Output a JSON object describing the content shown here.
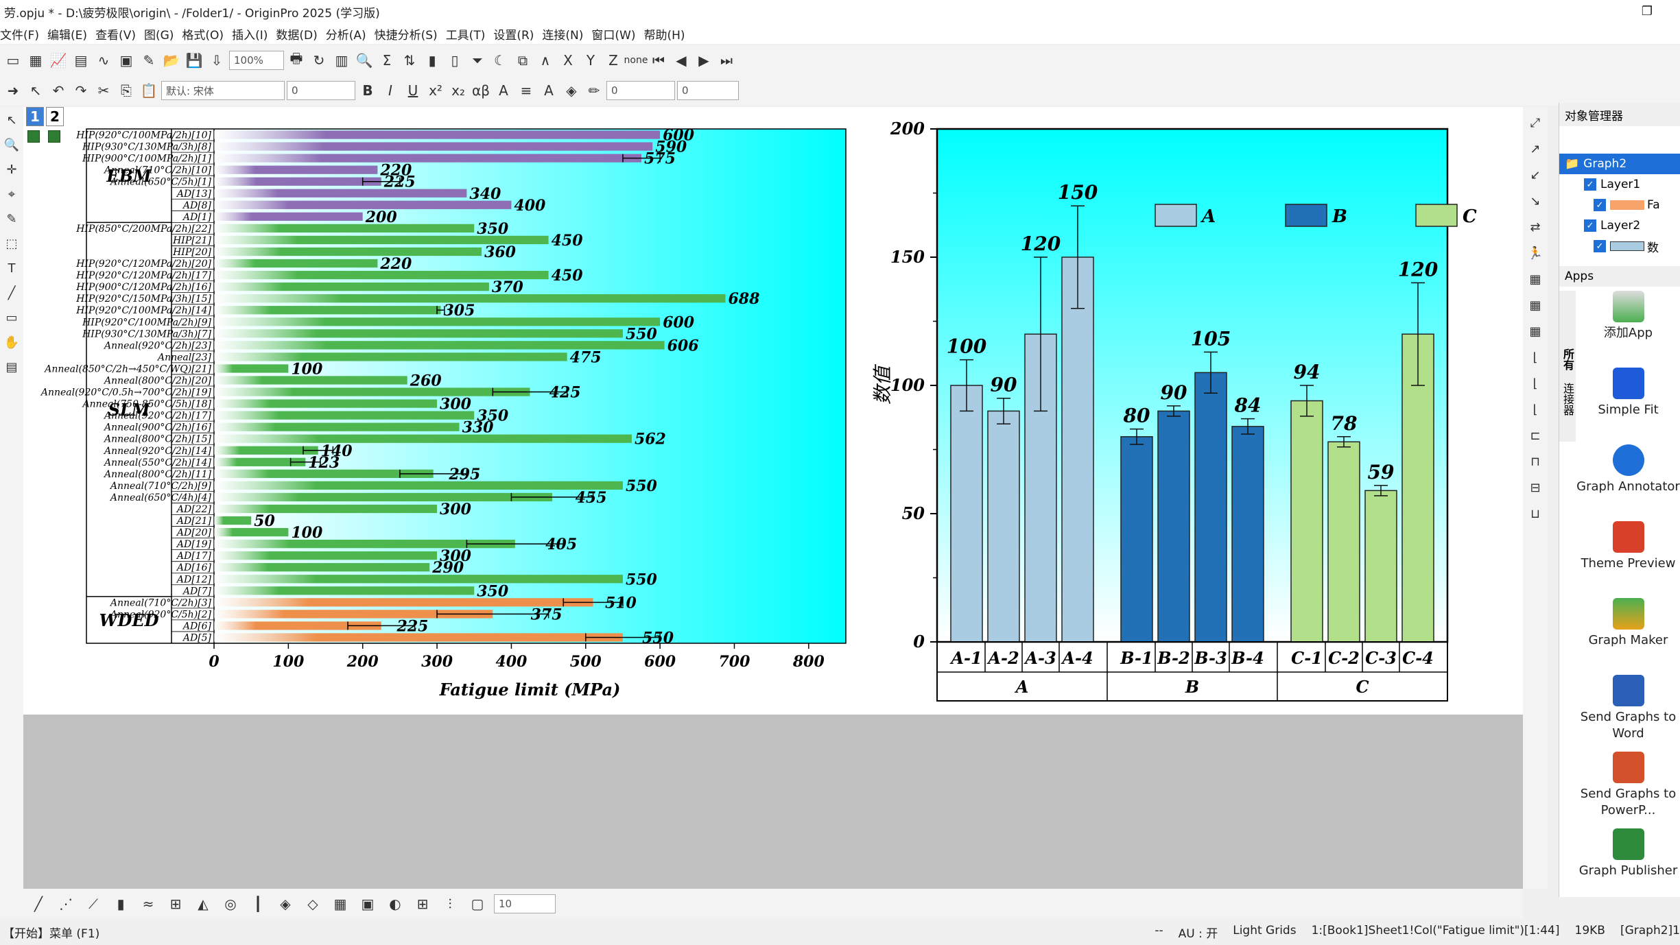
{
  "window": {
    "title": "劳.opju * - D:\\疲劳极限\\origin\\ - /Folder1/ - OriginPro 2025 (学习版)"
  },
  "menu": [
    "文件(F)",
    "编辑(E)",
    "查看(V)",
    "图(G)",
    "格式(O)",
    "插入(I)",
    "数据(D)",
    "分析(A)",
    "快捷分析(S)",
    "工具(T)",
    "设置(R)",
    "连接(N)",
    "窗口(W)",
    "帮助(H)"
  ],
  "toolbar": {
    "zoom": "100%",
    "font_name": "默认: 宋体",
    "font_size": "0",
    "line_width": "0",
    "fill_value": "0",
    "font_size_bottom": "10",
    "fit_none": "none"
  },
  "page_tabs": [
    "1",
    "2"
  ],
  "object_manager": {
    "title": "对象管理器",
    "graph": "Graph2",
    "layer1": "Layer1",
    "layer2": "Layer2",
    "item1": "Fa",
    "item2": "数"
  },
  "apps": {
    "title": "Apps",
    "tab_all": "所有",
    "tab_connector": "连接器",
    "items": [
      "添加App",
      "Simple Fit",
      "Graph Annotator",
      "Theme Preview",
      "Graph Maker",
      "Send Graphs to Word",
      "Send Graphs to PowerP...",
      "Graph Publisher"
    ]
  },
  "status": {
    "left": "【开始】菜单 (F1)",
    "dash": "--",
    "au": "AU : 开",
    "grids": "Light Grids",
    "col": "1:[Book1]Sheet1!Col(\"Fatigue limit\")[1:44]",
    "size": "19KB",
    "graph": "[Graph2]1"
  },
  "colors": {
    "ebm": "#8e6fb5",
    "slm": "#4db64e",
    "wded": "#ef8f4c",
    "a": "#a9cce3",
    "b": "#2270b5",
    "c": "#b2df8a",
    "bg_cyan": "#00ffff"
  },
  "chart_data": [
    {
      "type": "bar",
      "orientation": "horizontal",
      "xlabel": "Fatigue limit (MPa)",
      "xlim": [
        0,
        850
      ],
      "xticks": [
        0,
        100,
        200,
        300,
        400,
        500,
        600,
        700,
        800
      ],
      "groups": [
        {
          "name": "EBM",
          "color": "#8e6fb5",
          "items": [
            {
              "label": "HIP(920°C/100MPa/2h)[10]",
              "value": 600,
              "err": 0
            },
            {
              "label": "HIP(930°C/130MPa/3h)[8]",
              "value": 590,
              "err": 0
            },
            {
              "label": "HIP(900°C/100MPa/2h)[1]",
              "value": 575,
              "err": 25
            },
            {
              "label": "Anneal(710°C/2h)[10]",
              "value": 220,
              "err": 0
            },
            {
              "label": "Anneal(650°C/5h)[1]",
              "value": 225,
              "err": 25
            },
            {
              "label": "AD[13]",
              "value": 340,
              "err": 0
            },
            {
              "label": "AD[8]",
              "value": 400,
              "err": 0
            },
            {
              "label": "AD[1]",
              "value": 200,
              "err": 0
            }
          ]
        },
        {
          "name": "SLM",
          "color": "#4db64e",
          "items": [
            {
              "label": "HIP(850°C/200MPa/2h)[22]",
              "value": 350,
              "err": 0
            },
            {
              "label": "HIP[21]",
              "value": 450,
              "err": 0
            },
            {
              "label": "HIP[20]",
              "value": 360,
              "err": 0
            },
            {
              "label": "HIP(920°C/120MPa/2h)[20]",
              "value": 220,
              "err": 0
            },
            {
              "label": "HIP(920°C/120MPa/2h)[17]",
              "value": 450,
              "err": 0
            },
            {
              "label": "HIP(900°C/120MPa/2h)[16]",
              "value": 370,
              "err": 0
            },
            {
              "label": "HIP(920°C/150MPa/3h)[15]",
              "value": 688,
              "err": 0
            },
            {
              "label": "HIP(920°C/100MPa/2h)[14]",
              "value": 305,
              "err": 5
            },
            {
              "label": "HIP(920°C/100MPa/2h)[9]",
              "value": 600,
              "err": 0
            },
            {
              "label": "HIP(930°C/130MPa/3h)[7]",
              "value": 550,
              "err": 0
            },
            {
              "label": "Anneal(920°C/2h)[23]",
              "value": 606,
              "err": 0
            },
            {
              "label": "Anneal[23]",
              "value": 475,
              "err": 0
            },
            {
              "label": "Anneal(850°C/2h→450°C/WQ)[21]",
              "value": 100,
              "err": 0
            },
            {
              "label": "Anneal(800°C/2h)[20]",
              "value": 260,
              "err": 0
            },
            {
              "label": "Anneal(920°C/0.5h→700°C/2h)[19]",
              "value": 425,
              "err": 50
            },
            {
              "label": "Anneal(750-850°C/5h)[18]",
              "value": 300,
              "err": 0
            },
            {
              "label": "Anneal(920°C/2h)[17]",
              "value": 350,
              "err": 0
            },
            {
              "label": "Anneal(900°C/2h)[16]",
              "value": 330,
              "err": 0
            },
            {
              "label": "Anneal(800°C/2h)[15]",
              "value": 562,
              "err": 0
            },
            {
              "label": "Anneal(920°C/2h)[14]",
              "value": 140,
              "err": 20
            },
            {
              "label": "Anneal(550°C/2h)[14]",
              "value": 123,
              "err": 20
            },
            {
              "label": "Anneal(800°C/2h)[11]",
              "value": 295,
              "err": 45
            },
            {
              "label": "Anneal(710°C/2h)[9]",
              "value": 550,
              "err": 0
            },
            {
              "label": "Anneal(650°C/4h)[4]",
              "value": 455,
              "err": 55
            },
            {
              "label": "AD[22]",
              "value": 300,
              "err": 0
            },
            {
              "label": "AD[21]",
              "value": 50,
              "err": 0
            },
            {
              "label": "AD[20]",
              "value": 100,
              "err": 0
            },
            {
              "label": "AD[19]",
              "value": 405,
              "err": 65
            },
            {
              "label": "AD[17]",
              "value": 300,
              "err": 0
            },
            {
              "label": "AD[16]",
              "value": 290,
              "err": 0
            },
            {
              "label": "AD[12]",
              "value": 550,
              "err": 0
            },
            {
              "label": "AD[7]",
              "value": 350,
              "err": 0
            }
          ]
        },
        {
          "name": "WDED",
          "color": "#ef8f4c",
          "items": [
            {
              "label": "Anneal(710°C/2h)[3]",
              "value": 510,
              "err": 40
            },
            {
              "label": "Anneal(920°C/5h)[2]",
              "value": 375,
              "err": 75
            },
            {
              "label": "AD[6]",
              "value": 225,
              "err": 45
            },
            {
              "label": "AD[5]",
              "value": 550,
              "err": 50
            }
          ]
        }
      ]
    },
    {
      "type": "bar",
      "ylabel": "数值",
      "ylim": [
        0,
        200
      ],
      "yticks": [
        0,
        50,
        100,
        150,
        200
      ],
      "legend": "top",
      "legend_entries": [
        "A",
        "B",
        "C"
      ],
      "groups": [
        {
          "name": "A",
          "color": "#a9cce3",
          "labels": [
            "A-1",
            "A-2",
            "A-3",
            "A-4"
          ],
          "values": [
            100,
            90,
            120,
            150
          ],
          "errors": [
            10,
            5,
            30,
            20
          ]
        },
        {
          "name": "B",
          "color": "#2270b5",
          "labels": [
            "B-1",
            "B-2",
            "B-3",
            "B-4"
          ],
          "values": [
            80,
            90,
            105,
            84
          ],
          "errors": [
            3,
            2,
            8,
            3
          ]
        },
        {
          "name": "C",
          "color": "#b2df8a",
          "labels": [
            "C-1",
            "C-2",
            "C-3",
            "C-4"
          ],
          "values": [
            94,
            78,
            59,
            120
          ],
          "errors": [
            6,
            2,
            2,
            20
          ]
        }
      ]
    }
  ]
}
